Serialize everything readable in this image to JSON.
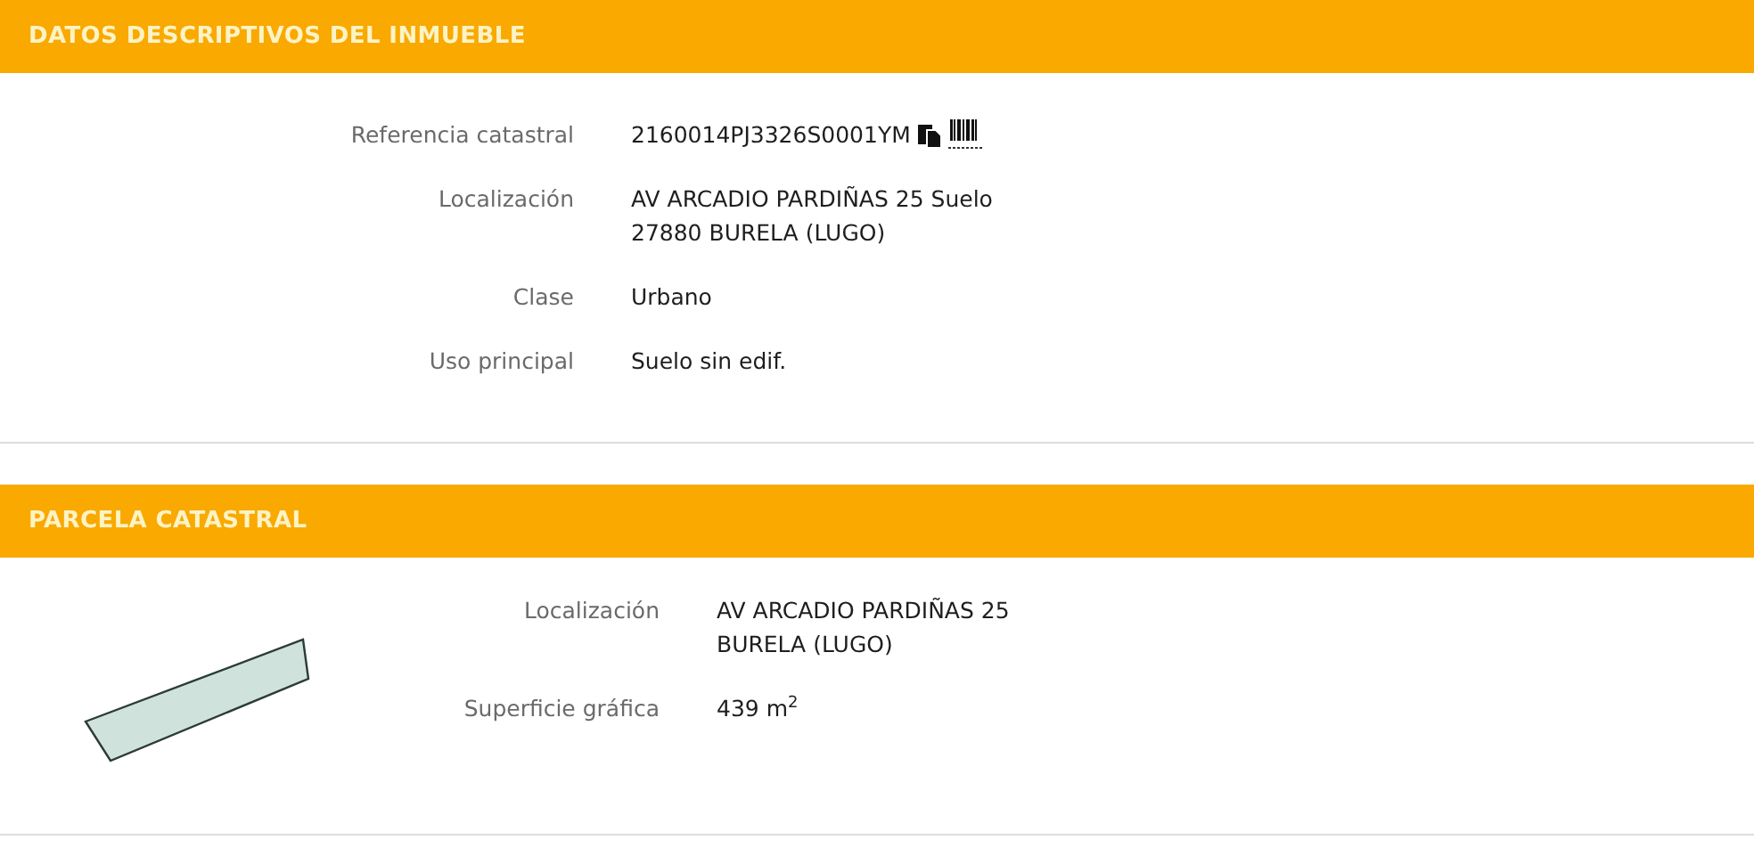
{
  "sections": [
    {
      "title": "DATOS DESCRIPTIVOS DEL INMUEBLE",
      "kind": "details",
      "rows": [
        {
          "label": "Referencia catastral",
          "kind": "reference",
          "lines": [
            "2160014PJ3326S0001YM"
          ]
        },
        {
          "label": "Localización",
          "kind": "text",
          "lines": [
            "AV ARCADIO PARDIÑAS 25 Suelo",
            "27880 BURELA (LUGO)"
          ]
        },
        {
          "label": "Clase",
          "kind": "text",
          "lines": [
            "Urbano"
          ]
        },
        {
          "label": "Uso principal",
          "kind": "text",
          "lines": [
            "Suelo sin edif."
          ]
        }
      ]
    },
    {
      "title": "PARCELA CATASTRAL",
      "kind": "parcel",
      "rows": [
        {
          "label": "Localización",
          "kind": "text",
          "lines": [
            "AV ARCADIO PARDIÑAS 25",
            "BURELA (LUGO)"
          ]
        },
        {
          "label": "Superficie gráfica",
          "kind": "text",
          "lines": [
            "439 m$^{2}$"
          ]
        }
      ]
    }
  ]
}
